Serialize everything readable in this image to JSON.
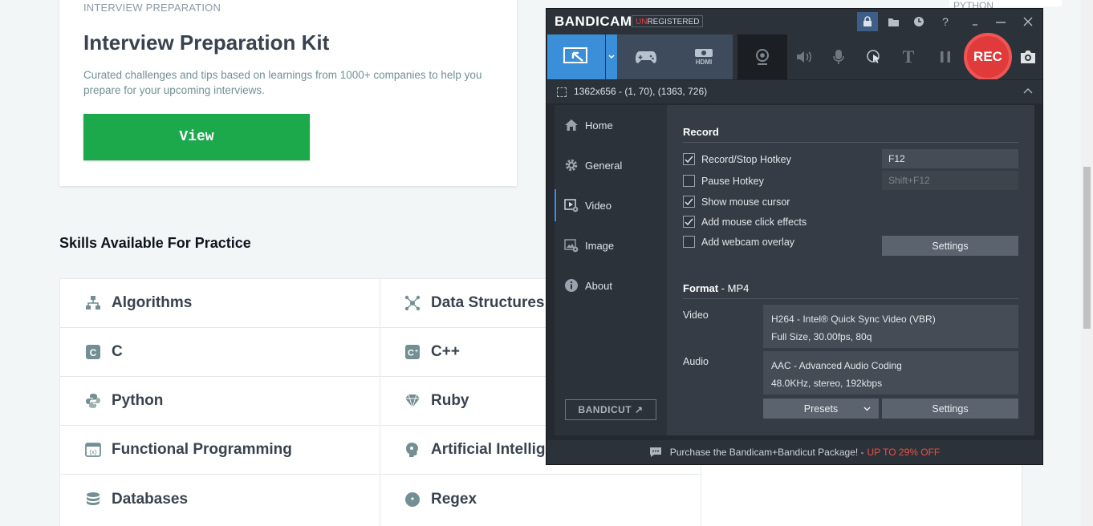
{
  "kit": {
    "eyebrow": "INTERVIEW PREPARATION",
    "title": "Interview Preparation Kit",
    "description": "Curated challenges and tips based on learnings from 1000+ companies to help you prepare for your upcoming interviews.",
    "view_label": "View"
  },
  "right_card": {
    "eyebrow": "PYTHON"
  },
  "skills": {
    "heading": "Skills Available For Practice",
    "left": [
      {
        "label": "Algorithms",
        "icon": "algorithms-icon"
      },
      {
        "label": "C",
        "icon": "c-icon"
      },
      {
        "label": "Python",
        "icon": "python-icon"
      },
      {
        "label": "Functional Programming",
        "icon": "functional-icon"
      },
      {
        "label": "Databases",
        "icon": "database-icon"
      }
    ],
    "right": [
      {
        "label": "Data Structures",
        "icon": "data-structures-icon"
      },
      {
        "label": "C++",
        "icon": "cpp-icon"
      },
      {
        "label": "Ruby",
        "icon": "ruby-icon"
      },
      {
        "label": "Artificial Intelligence",
        "icon": "ai-icon"
      },
      {
        "label": "Regex",
        "icon": "regex-icon"
      }
    ]
  },
  "bandicam": {
    "logo": "BANDICAM",
    "unregistered_prefix": "UN",
    "unregistered_rest": "REGISTERED",
    "title_buttons": [
      "lock-icon",
      "folder-icon",
      "clock-icon",
      "help-icon",
      "minimize-icon",
      "restore-icon",
      "close-icon"
    ],
    "help_glyph": "?",
    "mode_hdmi_label": "HDMI",
    "rec_label": "REC",
    "text_tool_glyph": "T",
    "resolution": "1362x656 - (1, 70), (1363, 726)",
    "nav": [
      {
        "label": "Home",
        "icon": "home-icon"
      },
      {
        "label": "General",
        "icon": "gear-icon"
      },
      {
        "label": "Video",
        "icon": "video-settings-icon"
      },
      {
        "label": "Image",
        "icon": "image-settings-icon"
      },
      {
        "label": "About",
        "icon": "info-icon"
      }
    ],
    "bandicut_label": "BANDICUT ↗",
    "record": {
      "title": "Record",
      "options": [
        {
          "label": "Record/Stop Hotkey",
          "checked": true
        },
        {
          "label": "Pause Hotkey",
          "checked": false
        },
        {
          "label": "Show mouse cursor",
          "checked": true
        },
        {
          "label": "Add mouse click effects",
          "checked": true
        },
        {
          "label": "Add webcam overlay",
          "checked": false
        }
      ],
      "record_hotkey": "F12",
      "pause_hotkey": "Shift+F12",
      "settings_label": "Settings"
    },
    "format": {
      "title": "Format",
      "container": " - MP4",
      "video_label": "Video",
      "video_line1": "H264 - Intel® Quick Sync Video (VBR)",
      "video_line2": "Full Size, 30.00fps, 80q",
      "audio_label": "Audio",
      "audio_line1": "AAC - Advanced Audio Coding",
      "audio_line2": "48.0KHz, stereo, 192kbps",
      "presets_label": "Presets",
      "settings_label": "Settings"
    },
    "footer": {
      "text": "Purchase the Bandicam+Bandicut Package! -",
      "promo": "UP TO 29% OFF"
    },
    "colors": {
      "accent": "#3b8fd8",
      "rec": "#e03a3a",
      "promo": "#f04f3f"
    }
  },
  "colors": {
    "view_button": "#1ba94c"
  }
}
